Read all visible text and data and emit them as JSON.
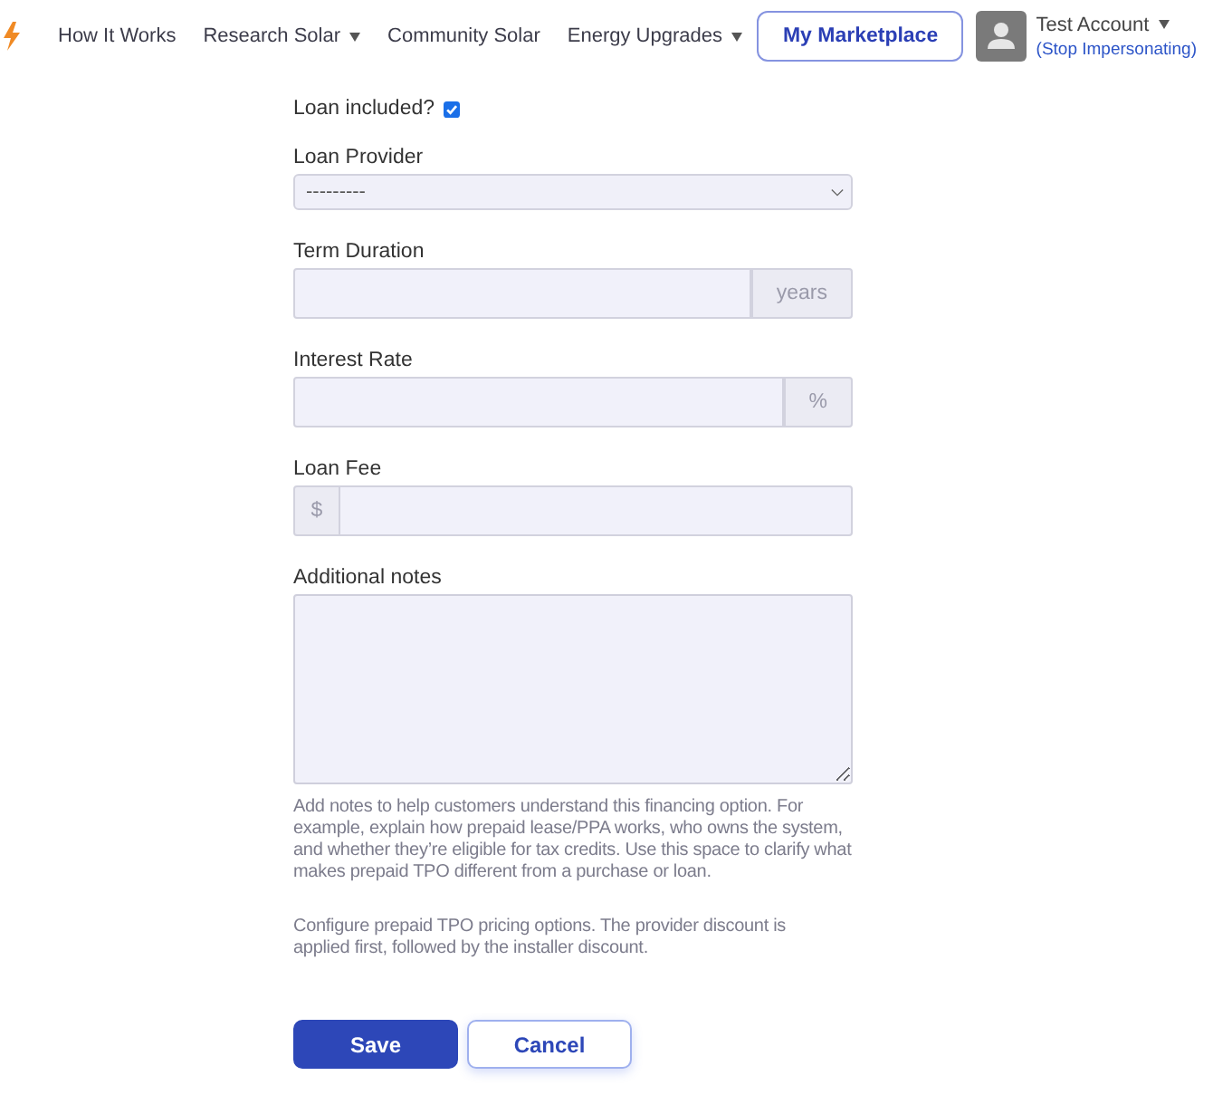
{
  "nav": {
    "items": [
      {
        "label": "How It Works",
        "has_menu": false
      },
      {
        "label": "Research Solar",
        "has_menu": true
      },
      {
        "label": "Community Solar",
        "has_menu": false
      },
      {
        "label": "Energy Upgrades",
        "has_menu": true
      }
    ],
    "marketplace_button": "My Marketplace",
    "account": {
      "name": "Test Account",
      "has_menu": true,
      "stop_link": "(Stop Impersonating)"
    }
  },
  "form": {
    "loan_included": {
      "label": "Loan included?",
      "checked": true
    },
    "fields": [
      {
        "kind": "select",
        "label": "Loan Provider",
        "value": "---------"
      },
      {
        "kind": "suffix",
        "label": "Term Duration",
        "addon": "years"
      },
      {
        "kind": "suffix",
        "label": "Interest Rate",
        "addon": "%"
      },
      {
        "kind": "prefix",
        "label": "Loan Fee",
        "addon": "$"
      },
      {
        "kind": "textarea",
        "label": "Additional notes"
      }
    ],
    "help_texts": [
      "Add notes to help customers understand this financing option. For example, explain how prepaid lease/PPA works, who owns the system, and whether they’re eligible for tax credits. Use this space to clarify what makes prepaid TPO different from a purchase or loan.",
      "Configure prepaid TPO pricing options. The provider discount is applied first, followed by the installer discount."
    ],
    "buttons": [
      {
        "label": "Save",
        "kind": "primary"
      },
      {
        "label": "Cancel",
        "kind": "secondary"
      }
    ]
  }
}
